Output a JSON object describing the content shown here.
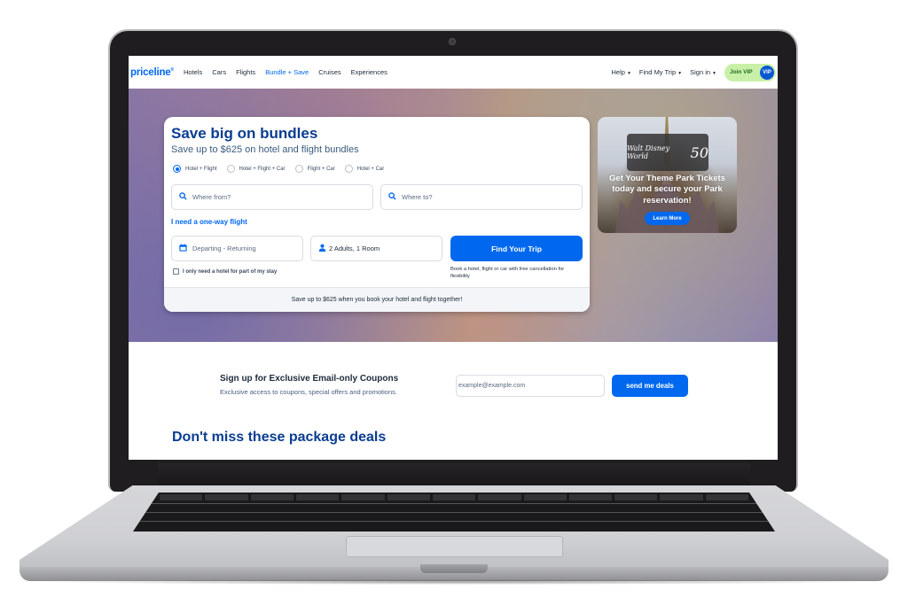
{
  "nav": {
    "logo": "priceline",
    "links": [
      "Hotels",
      "Cars",
      "Flights",
      "Bundle + Save",
      "Cruises",
      "Experiences"
    ],
    "active_link": "Bundle + Save",
    "right": {
      "help": "Help",
      "find_trip": "Find My Trip",
      "sign_in": "Sign in",
      "join_vip": "Join VIP",
      "vip_badge": "VIP"
    }
  },
  "search_card": {
    "title": "Save big on bundles",
    "subtitle": "Save up to $625 on hotel and flight bundles",
    "options": [
      "Hotel + Flight",
      "Hotel + Flight + Car",
      "Flight + Car",
      "Hotel + Car"
    ],
    "selected_option": "Hotel + Flight",
    "from_placeholder": "Where from?",
    "to_placeholder": "Where to?",
    "one_way_link": "I need a one-way flight",
    "dates_placeholder": "Departing - Returning",
    "guests_value": "2 Adults, 1 Room",
    "find_button": "Find Your Trip",
    "partial_stay_label": "I only need a hotel for part of my stay",
    "partial_stay_checked": false,
    "free_cancel_note": "Book a hotel, flight or car with free cancellation for flexibility",
    "footer": "Save up to $625 when you book your hotel and flight together!"
  },
  "ad": {
    "logo_text": "Walt Disney World",
    "logo_number": "50",
    "headline": "Get Your Theme Park Tickets today and secure your Park reservation!",
    "button": "Learn More"
  },
  "newsletter": {
    "title": "Sign up for Exclusive Email-only Coupons",
    "subtitle": "Exclusive access to coupons, special offers and promotions.",
    "input_placeholder": "example@example.com",
    "button": "send me deals"
  },
  "deals": {
    "title": "Don't miss these package deals"
  },
  "icons": {
    "search": "⚲",
    "calendar": "▦",
    "person": "👤",
    "caret": "▼"
  },
  "colors": {
    "brand_blue": "#0068ef",
    "heading_navy": "#0a3d91",
    "vip_green": "#c9f0a8"
  }
}
